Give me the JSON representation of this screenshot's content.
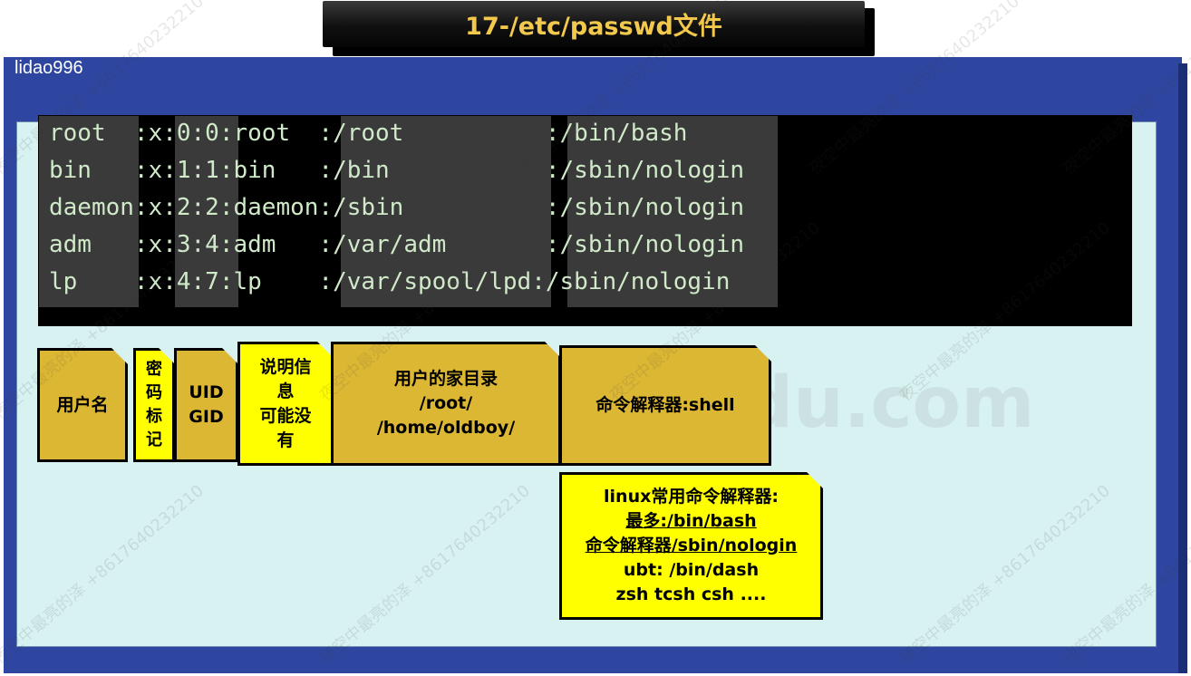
{
  "title": "17-/etc/passwd文件",
  "frame_label": "lidao996",
  "terminal": {
    "lines": [
      "root  :x:0:0:root  :/root          :/bin/bash",
      "bin   :x:1:1:bin   :/bin           :/sbin/nologin",
      "daemon:x:2:2:daemon:/sbin          :/sbin/nologin",
      "adm   :x:3:4:adm   :/var/adm       :/sbin/nologin",
      "lp    :x:4:7:lp    :/var/spool/lpd:/sbin/nologin"
    ]
  },
  "notes": {
    "username": "用户名",
    "password": [
      "密",
      "码",
      "标",
      "记"
    ],
    "uid_gid": [
      "UID",
      "GID"
    ],
    "description": [
      "说明信",
      "息",
      "可能没",
      "有"
    ],
    "home": [
      "用户的家目录",
      "/root/",
      "/home/oldboy/"
    ],
    "shell": "命令解释器:shell",
    "shells": {
      "line1": "linux常用命令解释器:",
      "line2": "最多:/bin/bash",
      "line3": "命令解释器/sbin/nologin",
      "line4": "ubt: /bin/dash",
      "line5": "zsh  tcsh  csh ...."
    }
  },
  "watermark": {
    "text": "夜空中最亮的泽 +8617640232210",
    "brand": "oldboyedu.com"
  },
  "colors": {
    "frame": "#2f46a0",
    "inner": "#d8f2f2",
    "note_gold": "#dcb734",
    "note_yellow": "#ffff00",
    "title_text": "#f2c94c",
    "terminal_text": "#cfe9c9"
  }
}
